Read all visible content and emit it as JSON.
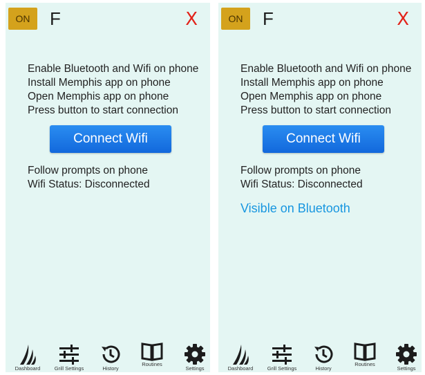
{
  "colors": {
    "screen_bg": "#e4f6f3",
    "power_badge": "#d4a21c",
    "close": "#e2231a",
    "button": "#1a7ae8",
    "bluetooth_text": "#1796e0"
  },
  "screens": [
    {
      "header": {
        "power_label": "ON",
        "unit_label": "F",
        "close_label": "X"
      },
      "instructions": [
        "Enable Bluetooth and Wifi on phone",
        "Install Memphis app on phone",
        "Open Memphis app on phone",
        "Press button to start connection"
      ],
      "connect_button": "Connect Wifi",
      "prompt_text": "Follow prompts on phone",
      "wifi_status": "Wifi Status: Disconnected",
      "bluetooth_status": "",
      "nav": [
        {
          "label": "Dashboard",
          "icon": "flame-icon"
        },
        {
          "label": "Grill Settings",
          "icon": "sliders-icon"
        },
        {
          "label": "History",
          "icon": "history-icon"
        },
        {
          "label": "Routines",
          "icon": "book-icon"
        },
        {
          "label": "Settings",
          "icon": "gear-icon"
        }
      ]
    },
    {
      "header": {
        "power_label": "ON",
        "unit_label": "F",
        "close_label": "X"
      },
      "instructions": [
        "Enable Bluetooth and Wifi on phone",
        "Install Memphis app on phone",
        "Open Memphis app on phone",
        "Press button to start connection"
      ],
      "connect_button": "Connect Wifi",
      "prompt_text": "Follow prompts on phone",
      "wifi_status": "Wifi Status: Disconnected",
      "bluetooth_status": "Visible on Bluetooth",
      "nav": [
        {
          "label": "Dashboard",
          "icon": "flame-icon"
        },
        {
          "label": "Grill Settings",
          "icon": "sliders-icon"
        },
        {
          "label": "History",
          "icon": "history-icon"
        },
        {
          "label": "Routines",
          "icon": "book-icon"
        },
        {
          "label": "Settings",
          "icon": "gear-icon"
        }
      ]
    }
  ]
}
